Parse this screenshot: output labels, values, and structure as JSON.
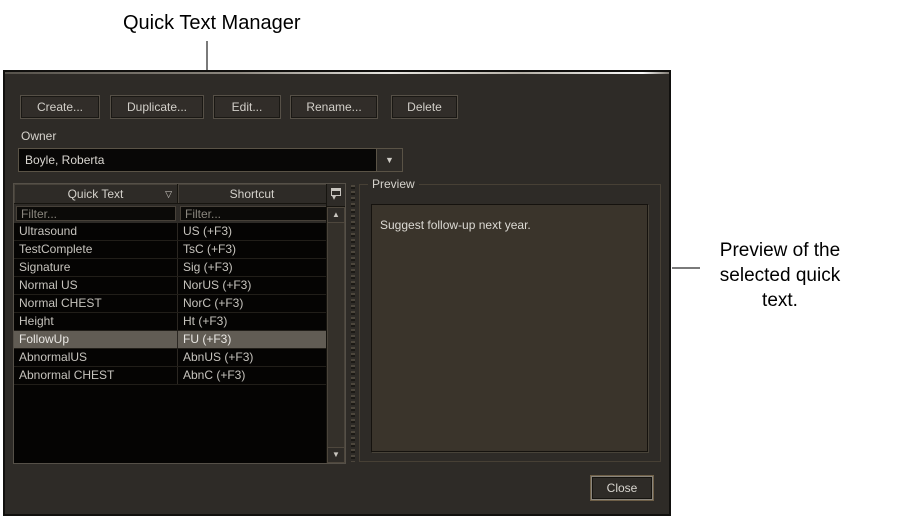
{
  "annotations": {
    "title": "Quick Text Manager",
    "preview_note": "Preview of the selected quick text."
  },
  "toolbar": {
    "buttons": [
      "Create...",
      "Duplicate...",
      "Edit...",
      "Rename...",
      "Delete"
    ]
  },
  "owner": {
    "label": "Owner",
    "value": "Boyle, Roberta"
  },
  "grid": {
    "columns": [
      "Quick Text",
      "Shortcut"
    ],
    "filter_placeholder": "Filter...",
    "selected_index": 6,
    "rows": [
      {
        "quick_text": "Ultrasound",
        "shortcut": "US (+F3)"
      },
      {
        "quick_text": "TestComplete",
        "shortcut": "TsC (+F3)"
      },
      {
        "quick_text": "Signature",
        "shortcut": "Sig (+F3)"
      },
      {
        "quick_text": "Normal US",
        "shortcut": "NorUS (+F3)"
      },
      {
        "quick_text": "Normal CHEST",
        "shortcut": "NorC (+F3)"
      },
      {
        "quick_text": "Height",
        "shortcut": "Ht (+F3)"
      },
      {
        "quick_text": "FollowUp",
        "shortcut": "FU (+F3)"
      },
      {
        "quick_text": "AbnormalUS",
        "shortcut": "AbnUS (+F3)"
      },
      {
        "quick_text": "Abnormal CHEST",
        "shortcut": "AbnC (+F3)"
      }
    ]
  },
  "preview": {
    "label": "Preview",
    "text": "Suggest follow-up next year."
  },
  "footer": {
    "close_label": "Close"
  },
  "icons": {
    "combo_arrow": "▼",
    "sort_desc": "▽",
    "scroll_up": "▲",
    "scroll_down": "▼",
    "column_chooser_arrow": "▾"
  },
  "colors": {
    "dialog_bg": "#2e2b27",
    "grid_bg": "#050403",
    "selection_bg": "#615c54",
    "preview_bg": "#3a342b",
    "dialog_text": "#c9c6c0",
    "annotation_text": "#000000",
    "callout_line": "#7a7a7a",
    "close_focus_border": "#6e5f47"
  }
}
